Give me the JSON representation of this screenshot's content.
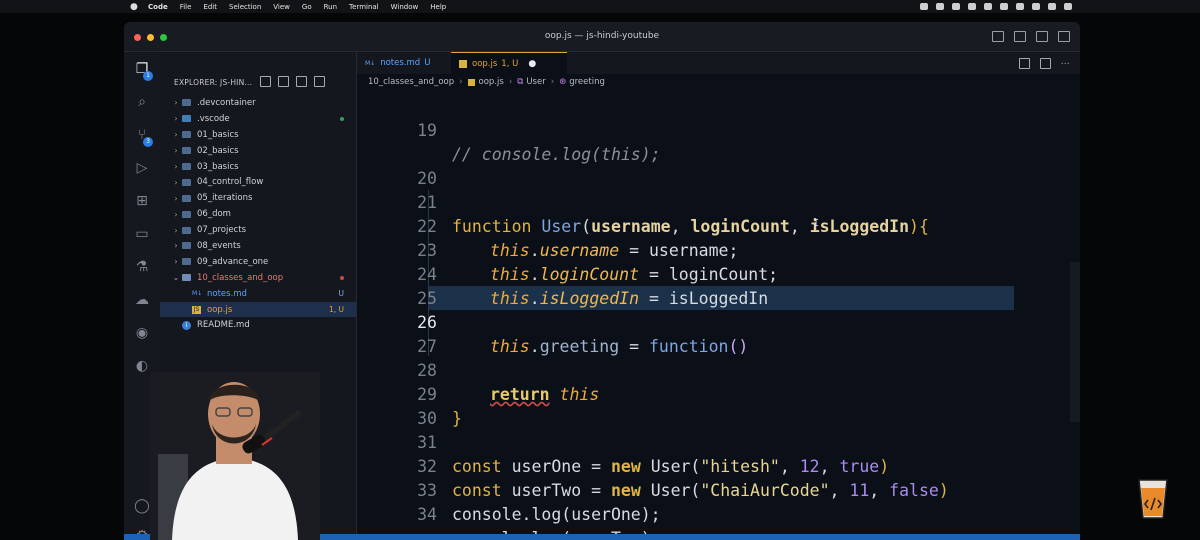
{
  "menubar": {
    "app": "Code",
    "items": [
      "File",
      "Edit",
      "Selection",
      "View",
      "Go",
      "Run",
      "Terminal",
      "Window",
      "Help"
    ]
  },
  "window": {
    "title": "oop.js — js-hindi-youtube"
  },
  "activity": {
    "explorer_badge": "1",
    "scm_badge": "3"
  },
  "sidebar": {
    "header": "EXPLORER: JS-HIN...",
    "items": [
      {
        "name": ".devcontainer",
        "type": "folder",
        "status": ""
      },
      {
        "name": ".vscode",
        "type": "folder",
        "status": "dot-green"
      },
      {
        "name": "01_basics",
        "type": "folder",
        "status": ""
      },
      {
        "name": "02_basics",
        "type": "folder",
        "status": ""
      },
      {
        "name": "03_basics",
        "type": "folder",
        "status": ""
      },
      {
        "name": "04_control_flow",
        "type": "folder",
        "status": ""
      },
      {
        "name": "05_iterations",
        "type": "folder",
        "status": ""
      },
      {
        "name": "06_dom",
        "type": "folder",
        "status": ""
      },
      {
        "name": "07_projects",
        "type": "folder",
        "status": ""
      },
      {
        "name": "08_events",
        "type": "folder",
        "status": ""
      },
      {
        "name": "09_advance_one",
        "type": "folder",
        "status": ""
      },
      {
        "name": "10_classes_and_oop",
        "type": "folder-open",
        "status": "dot-red"
      },
      {
        "name": "notes.md",
        "type": "md",
        "status": "U"
      },
      {
        "name": "oop.js",
        "type": "js",
        "status": "1, U"
      },
      {
        "name": "README.md",
        "type": "info",
        "status": ""
      }
    ]
  },
  "tabs": [
    {
      "label": "notes.md",
      "status": "U"
    },
    {
      "label": "oop.js",
      "status": "1, U"
    }
  ],
  "breadcrumb": [
    "10_classes_and_oop",
    "oop.js",
    "User",
    "greeting"
  ],
  "code": {
    "line_numbers": [
      "19",
      "20",
      "21",
      "22",
      "23",
      "24",
      "25",
      "26",
      "27",
      "28",
      "29",
      "30",
      "31",
      "32",
      "33",
      "34"
    ],
    "line19": "// console.log(this);",
    "line21": {
      "kw": "function",
      "name": "User",
      "open": "(",
      "p1": "username",
      "c1": ", ",
      "p2": "loginCount",
      "c2": ", ",
      "p3": "isLoggedIn",
      "close": "){"
    },
    "line22": {
      "this": "this",
      "dot": ".",
      "prop": "username",
      "rest": " = username;"
    },
    "line23": {
      "this": "this",
      "dot": ".",
      "prop": "loginCount",
      "rest": " = loginCount;"
    },
    "line24": {
      "this": "this",
      "dot": ".",
      "prop": "isLoggedIn",
      "rest": " = isLoggedIn"
    },
    "line26": {
      "this": "this",
      "dot": ".",
      "prop": "greeting",
      "eq": " = ",
      "fn": "function",
      "paren": "()"
    },
    "line28": {
      "kw": "return",
      "this": "this"
    },
    "line29": "}",
    "line31": {
      "kw": "const",
      "var": " userOne = ",
      "new": "new",
      "cls": " User(",
      "s": "\"hitesh\"",
      "c1": ", ",
      "n": "12",
      "c2": ", ",
      "b": "true",
      "end": ")"
    },
    "line32": {
      "kw": "const",
      "var": " userTwo = ",
      "new": "new",
      "cls": " User(",
      "s": "\"ChaiAurCode\"",
      "c1": ", ",
      "n": "11",
      "c2": ", ",
      "b": "false",
      "end": ")"
    },
    "line33": "console.log(userOne);",
    "line34": "console.log(userTwo);"
  },
  "colors": {
    "accent": "#2b7de9",
    "tab_active": "#e5a33b",
    "status_bar": "#1c62b5"
  }
}
